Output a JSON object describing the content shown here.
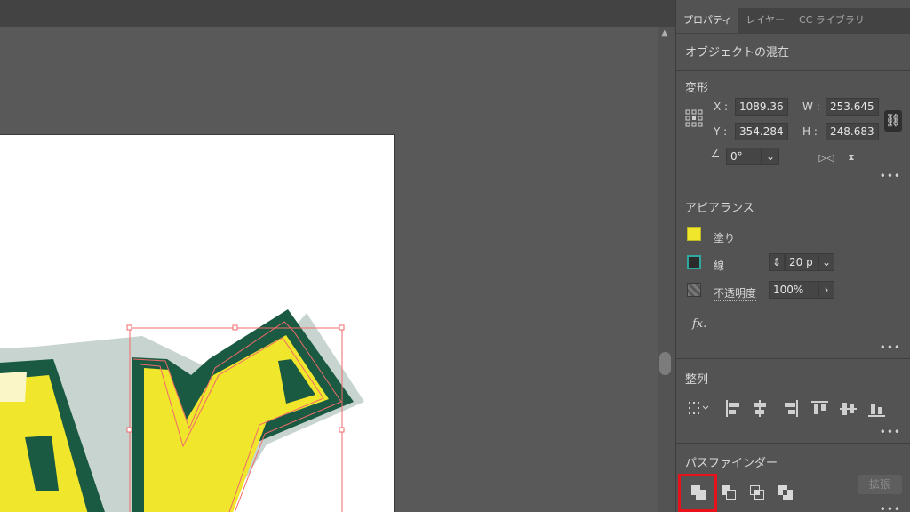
{
  "tabs": [
    {
      "label": "プロパティ"
    },
    {
      "label": "レイヤー"
    },
    {
      "label": "CC ライブラリ"
    }
  ],
  "selection_title": "オブジェクトの混在",
  "transform": {
    "title": "変形",
    "x_label": "X :",
    "x_value": "1089.36",
    "y_label": "Y :",
    "y_value": "354.284",
    "w_label": "W :",
    "w_value": "253.645",
    "h_label": "H :",
    "h_value": "248.683",
    "rotate_value": "0°"
  },
  "appearance": {
    "title": "アピアランス",
    "fill_label": "塗り",
    "fill_color": "#f0e72c",
    "stroke_label": "線",
    "stroke_width": "20 p",
    "stroke_color": "#2fa9a0",
    "opacity_label": "不透明度",
    "opacity_value": "100%",
    "fx_label": "fx."
  },
  "align": {
    "title": "整列"
  },
  "pathfinder": {
    "title": "パスファインダー",
    "expand_label": "拡張"
  },
  "more_label": "•••",
  "colors": {
    "highlight": "#e8101a",
    "art_green": "#1a5a43",
    "art_yellow": "#f0e72c",
    "art_shadow": "#c7d4cf",
    "selection": "#f06a6a"
  }
}
